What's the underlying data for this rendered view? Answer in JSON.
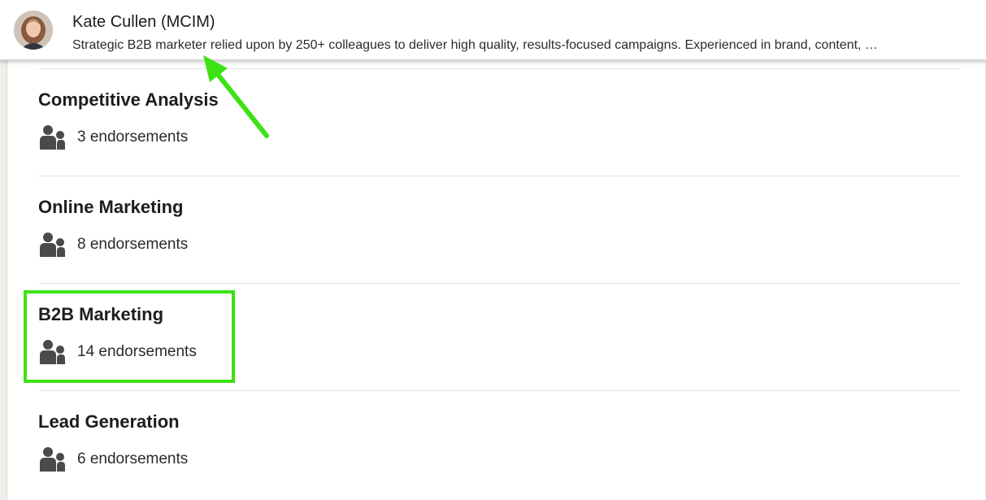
{
  "profile_header": {
    "name": "Kate Cullen (MCIM)",
    "headline": "Strategic B2B marketer relied upon by 250+ colleagues to deliver high quality, results-focused campaigns. Experienced in brand, content, …"
  },
  "skills": [
    {
      "name": "Competitive Analysis",
      "endorsements": "3 endorsements"
    },
    {
      "name": "Online Marketing",
      "endorsements": "8 endorsements"
    },
    {
      "name": "B2B Marketing",
      "endorsements": "14 endorsements"
    },
    {
      "name": "Lead Generation",
      "endorsements": "6 endorsements"
    }
  ],
  "annotations": {
    "color": "#3de215",
    "highlighted_skill": "B2B Marketing",
    "arrow_target": "headline"
  },
  "icons": {
    "endorsement_icon": "people-icon",
    "icon_color": "#4a4a4a"
  }
}
